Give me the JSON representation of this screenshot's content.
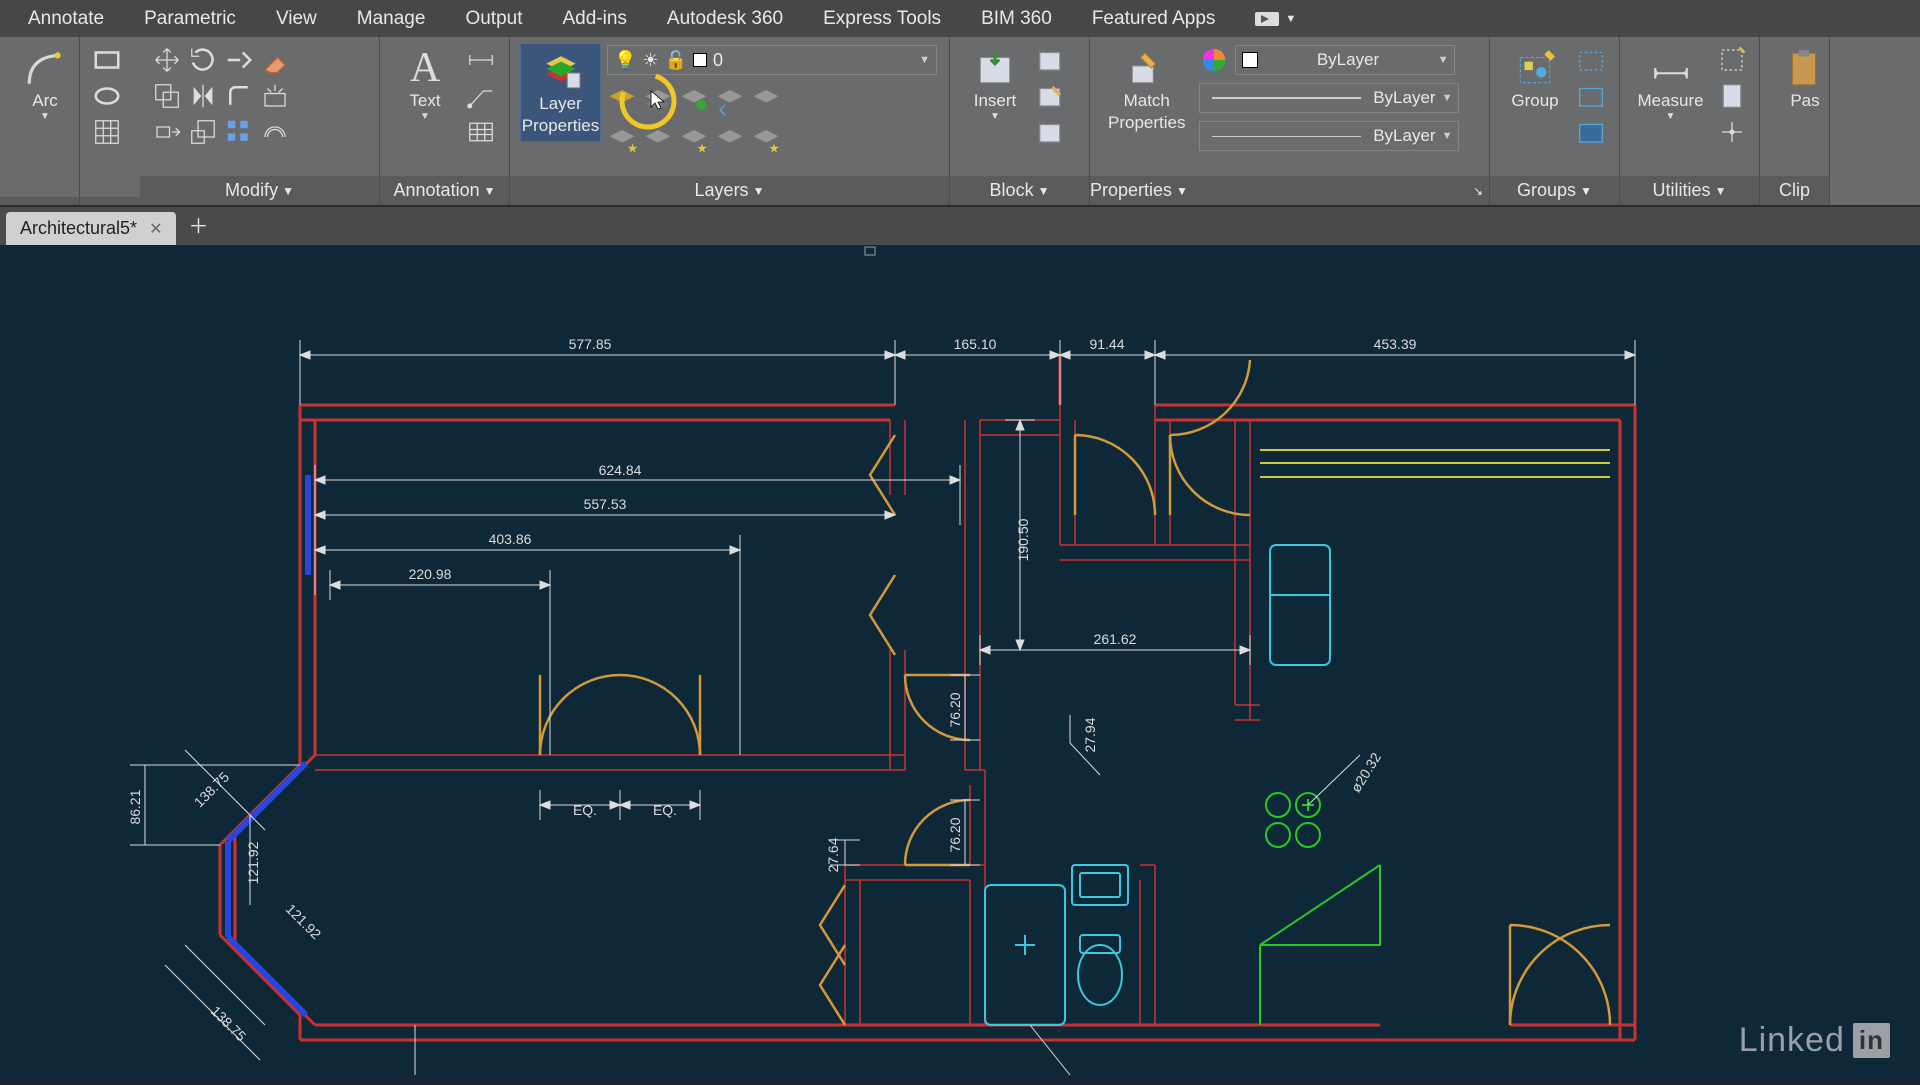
{
  "menu": {
    "items": [
      "Annotate",
      "Parametric",
      "View",
      "Manage",
      "Output",
      "Add-ins",
      "Autodesk 360",
      "Express Tools",
      "BIM 360",
      "Featured Apps"
    ]
  },
  "ribbon": {
    "draw": {
      "arc": "Arc"
    },
    "modify": {
      "title": "Modify"
    },
    "annotation": {
      "text": "Text",
      "title": "Annotation"
    },
    "layers": {
      "layer_properties_line1": "Layer",
      "layer_properties_line2": "Properties",
      "current_layer": "0",
      "title": "Layers"
    },
    "block": {
      "insert": "Insert",
      "title": "Block"
    },
    "properties": {
      "match": "Match",
      "match2": "Properties",
      "bylayer1": "ByLayer",
      "bylayer2": "ByLayer",
      "bylayer3": "ByLayer",
      "title": "Properties"
    },
    "groups": {
      "group": "Group",
      "title": "Groups"
    },
    "utilities": {
      "measure": "Measure",
      "title": "Utilities"
    },
    "clipboard": {
      "paste": "Pas",
      "title": "Clip"
    }
  },
  "tabs": {
    "active": "Architectural5*"
  },
  "dimensions": {
    "d1": "577.85",
    "d2": "165.10",
    "d3": "91.44",
    "d4": "453.39",
    "d5": "624.84",
    "d6": "557.53",
    "d7": "403.86",
    "d8": "220.98",
    "d9": "190.50",
    "d10": "261.62",
    "d11": "76.20",
    "d12": "27.94",
    "d13": "76.20",
    "d14": "27.64",
    "d15": "ø20.32",
    "d16": "86.21",
    "d17": "138.75",
    "d18": "121.92",
    "d19": "121.92",
    "d20": "138.75",
    "eq1": "EQ.",
    "eq2": "EQ."
  },
  "watermark": {
    "text": "Linked",
    "suffix": "in"
  },
  "colors": {
    "canvas_bg": "#0f2838",
    "wall": "#c83232",
    "door": "#d29a3a",
    "fixture": "#3ac8dc",
    "furniture": "#28c828",
    "dimension": "#dcdcdc",
    "window": "#2846dc"
  }
}
